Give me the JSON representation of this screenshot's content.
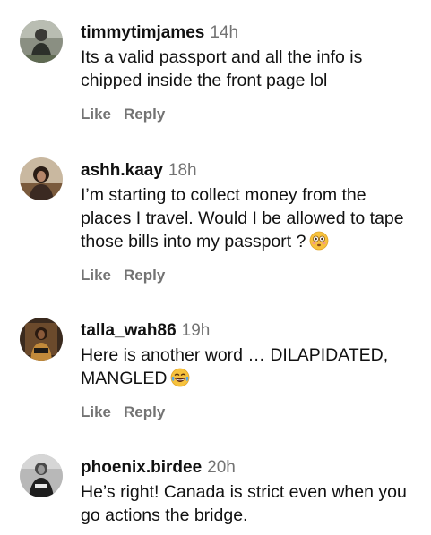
{
  "comments": [
    {
      "username": "timmytimjames",
      "time": "14h",
      "text": "Its a valid passport and all the info is chipped inside the front page lol",
      "like_label": "Like",
      "reply_label": "Reply"
    },
    {
      "username": "ashh.kaay",
      "time": "18h",
      "text": "I’m starting to collect money from the places I travel. Would I be allowed to tape those bills into my passport ?",
      "emoji": "flushed-face-emoji",
      "like_label": "Like",
      "reply_label": "Reply"
    },
    {
      "username": "talla_wah86",
      "time": "19h",
      "text": "Here is another word … DILAPIDATED, MANGLED",
      "emoji": "laughing-tears-emoji",
      "like_label": "Like",
      "reply_label": "Reply"
    },
    {
      "username": "phoenix.birdee",
      "time": "20h",
      "text": "He’s right! Canada is strict even when you go actions the bridge."
    }
  ]
}
